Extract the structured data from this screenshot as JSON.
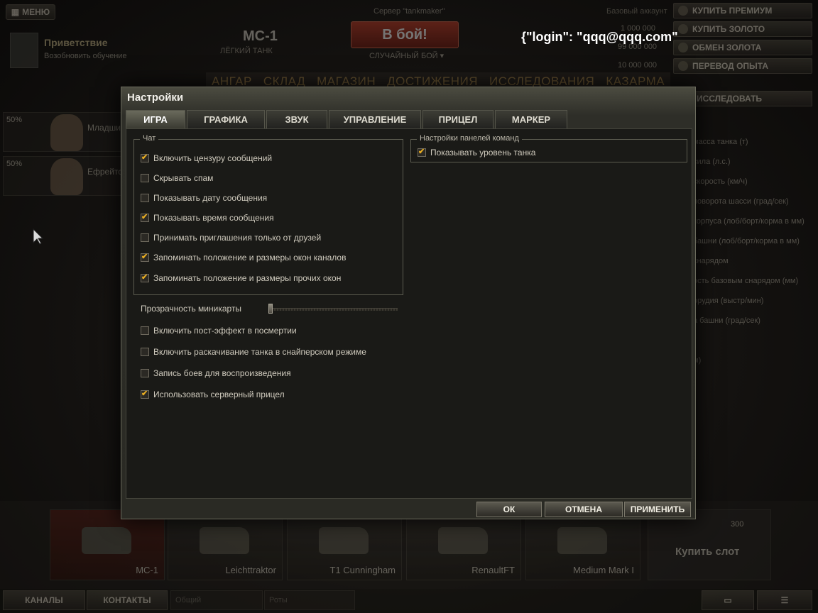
{
  "garage": {
    "menu_label": "МЕНЮ",
    "server": "Сервер \"tankmaker\"",
    "greeting": "Приветствие",
    "resume_training": "Возобновить обучение",
    "tank_name": "МС-1",
    "tank_type": "ЛЁГКИЙ ТАНК",
    "battle_label": "В бой!",
    "battle_mode": "СЛУЧАЙНЫЙ БОЙ ▾",
    "login_text": "{\"login\": \"qqq@qqq.com\"",
    "base_exp": "Базовый аккаунт",
    "credits": "1 000 000",
    "gold": "99 000 000",
    "free_xp": "10 000 000",
    "buy_premium": "Купить премиум",
    "buy_gold": "Купить золото",
    "exchange_gold": "Обмен золота",
    "transfer_xp": "Перевод опыта",
    "nav": [
      "Ангар",
      "Склад",
      "Магазин",
      "Достижения",
      "Исследования",
      "Казарма"
    ],
    "research": "ИССЛЕДОВАТЬ",
    "crew": [
      {
        "pct": "50%",
        "rank": "Младший"
      },
      {
        "pct": "50%",
        "rank": "Ефрейтор"
      }
    ],
    "params": [
      "масса танка (т)",
      "сила (л.с.)",
      "скорость (км/ч)",
      "поворота шасси (град/сек)",
      "корпуса (лоб/борт/корма в мм)",
      "башни (лоб/борт/корма в мм)",
      "снарядом",
      "ость базовым снарядом (мм)",
      "орудия (выстр/мин)",
      "а башни (град/сек)",
      "",
      "м)"
    ],
    "tanks": [
      "МС-1",
      "Leichttraktor",
      "T1 Cunningham",
      "RenaultFT",
      "Medium Mark I"
    ],
    "buy_slot": "Купить слот",
    "slot_price": "300",
    "channels": "КАНАЛЫ",
    "contacts": "КОНТАКТЫ",
    "common": "Общий",
    "companies": "Роты"
  },
  "dialog": {
    "title": "Настройки",
    "tabs": [
      "Игра",
      "Графика",
      "Звук",
      "Управление",
      "Прицел",
      "Маркер"
    ],
    "chat_legend": "Чат",
    "chat_options": [
      {
        "label": "Включить цензуру сообщений",
        "checked": true
      },
      {
        "label": "Скрывать спам",
        "checked": false
      },
      {
        "label": "Показывать дату сообщения",
        "checked": false
      },
      {
        "label": "Показывать время сообщения",
        "checked": true
      },
      {
        "label": "Принимать приглашения только от друзей",
        "checked": false
      },
      {
        "label": "Запоминать положение и размеры окон каналов",
        "checked": true
      },
      {
        "label": "Запоминать положение и размеры прочих окон",
        "checked": true
      }
    ],
    "team_legend": "Настройки панелей команд",
    "team_options": [
      {
        "label": "Показывать уровень танка",
        "checked": true
      }
    ],
    "minimap_label": "Прозрачность миникарты",
    "minimap_transparency": 0,
    "other_options": [
      {
        "label": "Включить пост-эффект в посмертии",
        "checked": false
      },
      {
        "label": "Включить раскачивание танка в снайперском режиме",
        "checked": false
      },
      {
        "label": "Запись боев для воспроизведения",
        "checked": false
      },
      {
        "label": "Использовать серверный прицел",
        "checked": true
      }
    ],
    "ok": "ОК",
    "cancel": "ОТМЕНА",
    "apply": "ПРИМЕНИТЬ"
  }
}
